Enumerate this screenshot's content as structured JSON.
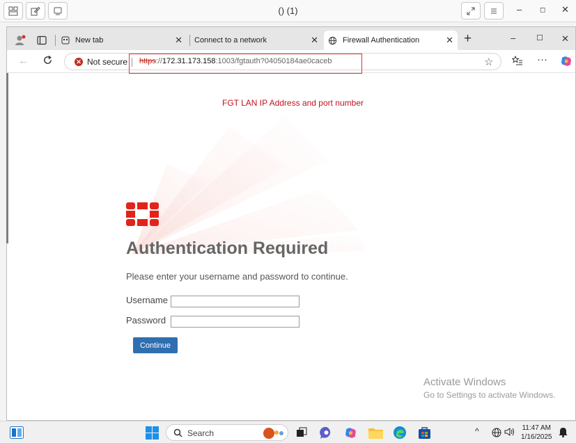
{
  "outer": {
    "title": "() (1)"
  },
  "browser": {
    "tabs": [
      {
        "label": "New tab",
        "active": false
      },
      {
        "label": "Connect to a network",
        "active": false
      },
      {
        "label": "Firewall Authentication",
        "active": true
      }
    ],
    "security_label": "Not secure",
    "url": {
      "protocol": "https",
      "separator": "://",
      "host": "172.31.173.158",
      "rest": ":1003/fgtauth?04050184ae0caceb"
    }
  },
  "annotation": {
    "text": "FGT LAN IP Address and port number",
    "color": "#c1121f"
  },
  "page": {
    "title": "Authentication Required",
    "subtitle": "Please enter your username and password to continue.",
    "username_label": "Username",
    "username_value": "",
    "password_label": "Password",
    "password_value": "",
    "continue_label": "Continue",
    "brand_color": "#e2231a",
    "button_color": "#2f6fb1"
  },
  "watermark": {
    "line1": "Activate Windows",
    "line2": "Go to Settings to activate Windows."
  },
  "taskbar": {
    "search_label": "Search",
    "time": "11:47 AM",
    "date": "1/16/2025"
  }
}
